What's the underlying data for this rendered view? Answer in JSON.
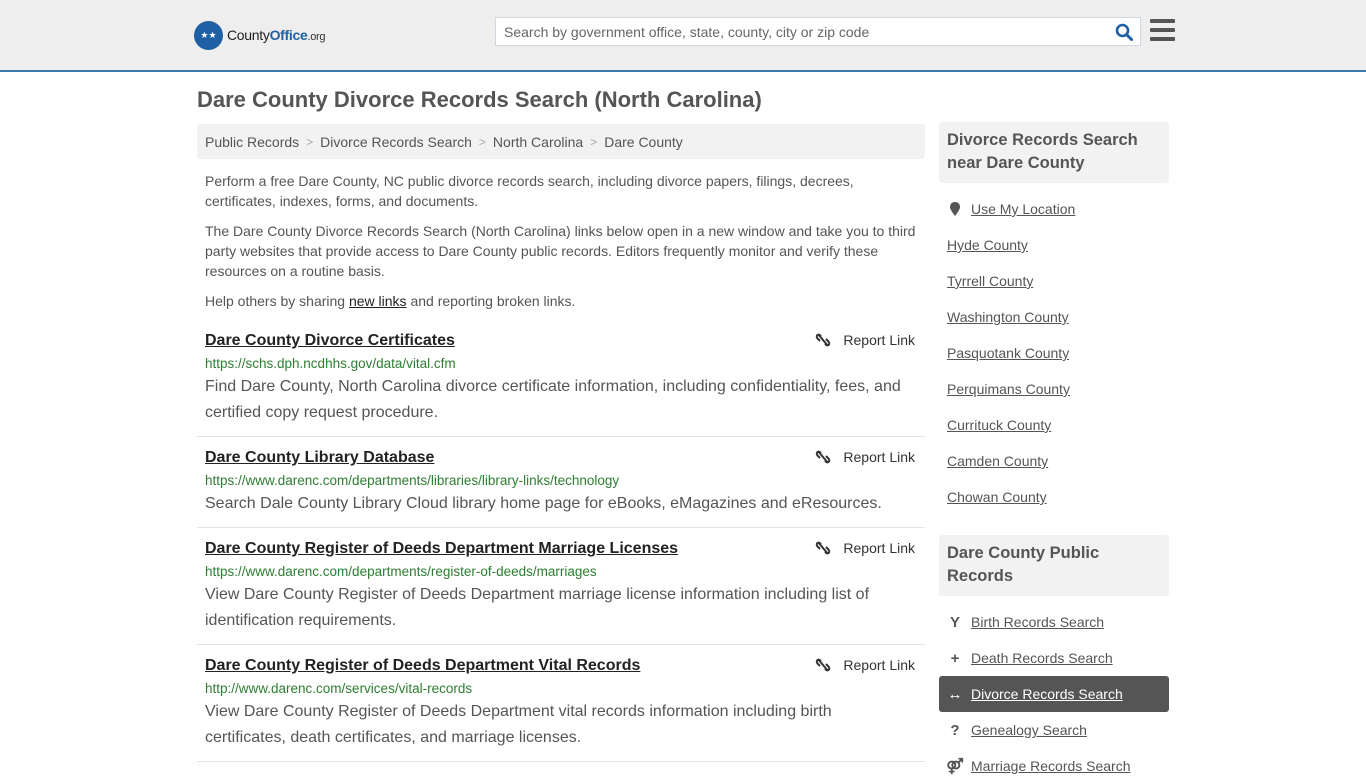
{
  "header": {
    "logo_prefix": "County",
    "logo_office": "Office",
    "logo_suffix": ".org",
    "search_placeholder": "Search by government office, state, county, city or zip code",
    "search_value": ""
  },
  "page": {
    "title": "Dare County Divorce Records Search (North Carolina)"
  },
  "breadcrumb": [
    {
      "label": "Public Records"
    },
    {
      "label": "Divorce Records Search"
    },
    {
      "label": "North Carolina"
    },
    {
      "label": "Dare County"
    }
  ],
  "intro": {
    "p1": "Perform a free Dare County, NC public divorce records search, including divorce papers, filings, decrees, certificates, indexes, forms, and documents.",
    "p2": "The Dare County Divorce Records Search (North Carolina) links below open in a new window and take you to third party websites that provide access to Dare County public records. Editors frequently monitor and verify these resources on a routine basis.",
    "p3_before": "Help others by sharing ",
    "p3_link": "new links",
    "p3_after": " and reporting broken links."
  },
  "report_label": "Report Link",
  "results": [
    {
      "title": "Dare County Divorce Certificates",
      "url": "https://schs.dph.ncdhhs.gov/data/vital.cfm",
      "desc": "Find Dare County, North Carolina divorce certificate information, including confidentiality, fees, and certified copy request procedure."
    },
    {
      "title": "Dare County Library Database",
      "url": "https://www.darenc.com/departments/libraries/library-links/technology",
      "desc": "Search Dale County Library Cloud library home page for eBooks, eMagazines and eResources."
    },
    {
      "title": "Dare County Register of Deeds Department Marriage Licenses",
      "url": "https://www.darenc.com/departments/register-of-deeds/marriages",
      "desc": "View Dare County Register of Deeds Department marriage license information including list of identification requirements."
    },
    {
      "title": "Dare County Register of Deeds Department Vital Records",
      "url": "http://www.darenc.com/services/vital-records",
      "desc": "View Dare County Register of Deeds Department vital records information including birth certificates, death certificates, and marriage licenses."
    }
  ],
  "sidebar": {
    "nearby_heading": "Divorce Records Search near Dare County",
    "use_location": "Use My Location",
    "nearby": [
      "Hyde County",
      "Tyrrell County",
      "Washington County",
      "Pasquotank County",
      "Perquimans County",
      "Currituck County",
      "Camden County",
      "Chowan County"
    ],
    "records_heading": "Dare County Public Records",
    "records": [
      {
        "label": "Birth Records Search",
        "icon": "child-icon",
        "glyph": "Y",
        "active": false
      },
      {
        "label": "Death Records Search",
        "icon": "plus-icon",
        "glyph": "+",
        "active": false
      },
      {
        "label": "Divorce Records Search",
        "icon": "arrows-horizontal-icon",
        "glyph": "↔",
        "active": true
      },
      {
        "label": "Genealogy Search",
        "icon": "question-icon",
        "glyph": "?",
        "active": false
      },
      {
        "label": "Marriage Records Search",
        "icon": "venus-mars-icon",
        "glyph": "⚤",
        "active": false
      }
    ]
  }
}
